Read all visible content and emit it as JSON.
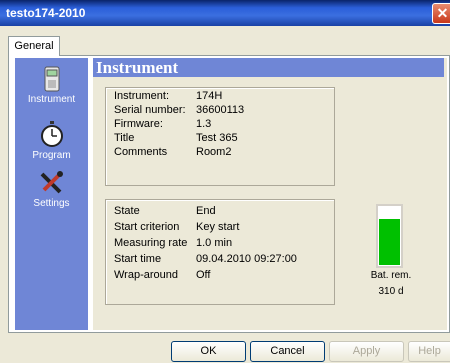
{
  "window": {
    "title": "testo174-2010",
    "close_glyph": "✕"
  },
  "tabs": [
    {
      "label": "General"
    }
  ],
  "sidebar": {
    "items": [
      {
        "label": "Instrument",
        "icon": "instrument-icon"
      },
      {
        "label": "Program",
        "icon": "stopwatch-icon"
      },
      {
        "label": "Settings",
        "icon": "tools-icon"
      }
    ]
  },
  "main": {
    "header": "Instrument",
    "info": [
      {
        "label": "Instrument:",
        "value": "174H"
      },
      {
        "label": "Serial number:",
        "value": "36600113"
      },
      {
        "label": "Firmware:",
        "value": "1.3"
      },
      {
        "label": "Title",
        "value": "Test 365"
      },
      {
        "label": "Comments",
        "value": "Room2"
      }
    ],
    "status": [
      {
        "label": "State",
        "value": "End"
      },
      {
        "label": "Start criterion",
        "value": "Key start"
      },
      {
        "label": "Measuring rate",
        "value": "1.0 min"
      },
      {
        "label": "Start time",
        "value": "09.04.2010 09:27:00"
      },
      {
        "label": "Wrap-around",
        "value": "Off"
      }
    ],
    "battery": {
      "label": "Bat. rem.",
      "value": "310  d",
      "level_fraction": 0.8,
      "fill_color": "#00c000"
    }
  },
  "buttons": {
    "ok": "OK",
    "cancel": "Cancel",
    "apply": "Apply",
    "help": "Help"
  }
}
